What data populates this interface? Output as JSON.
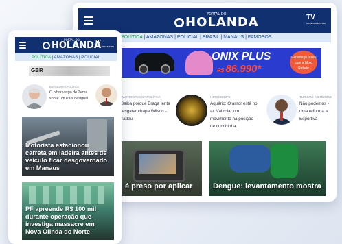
{
  "brand": {
    "small": "PORTAL DO",
    "name": "HOLANDA",
    "tv": "TV",
    "tv_sub": "mais amazonas"
  },
  "desktop": {
    "nav": [
      "POLÍTICA",
      "AMAZONAS",
      "POLICIAL",
      "BRASIL",
      "MANAUS",
      "FAMOSOS"
    ],
    "ad": {
      "title": "ONIX PLUS",
      "price_prefix": "R$ ",
      "price": "86.990*",
      "badge": "Garanta já o seu com a Moto Rebelo"
    },
    "columns": [
      {
        "cat": "BASTIDORES DA POLÍTICA",
        "text": "Saiba porque Braga tenta resgatar chapa Wilson - Tadeu"
      },
      {
        "cat": "HORÓSCOPO",
        "text": "Aquário: O amor está no ar. Vai rolar um movimento na posição de conchinha."
      },
      {
        "cat": "TURISMO AO MUNDO",
        "text": "Não podemos - uma reforma al Esportiva"
      }
    ],
    "cards": [
      "é preso por aplicar",
      "Dengue: levantamento mostra"
    ]
  },
  "mobile": {
    "nav": [
      "POLÍTICA",
      "AMAZONAS",
      "POLICIAL"
    ],
    "banner": "GBR",
    "columns": [
      {
        "cat": "BASTIDORES POLÍTICA",
        "text": "O olhar vergo de Zema sobre um País desigual"
      }
    ],
    "cards": [
      "Motorista estacionou carreta em ladeira antes de veículo ficar desgovernado em Manaus",
      "PF apreende R$ 100 mil durante operação que investiga massacre em Nova Olinda do Norte"
    ]
  },
  "colors": {
    "header": "#10306f",
    "nav_bg": "#dbe8f7",
    "active": "#18a84a",
    "ad_bg": "#2a3ccf",
    "price": "#ff4c3c"
  }
}
